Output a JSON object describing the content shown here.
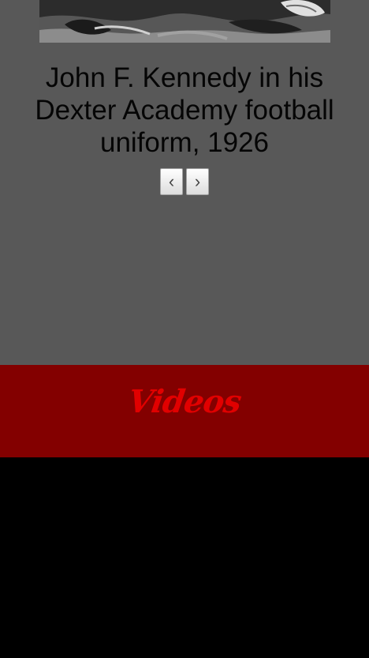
{
  "gallery": {
    "caption": "John F. Kennedy in his Dexter Academy football uniform, 1926",
    "navigation": {
      "previous_label": "‹",
      "next_label": "›"
    }
  },
  "videos": {
    "title": "Videos"
  },
  "colors": {
    "gallery_background": "#585858",
    "videos_band_background": "#830000",
    "videos_title_color": "#e10000",
    "lower_background": "#000000"
  },
  "icons": {
    "previous": "chevron-left-icon",
    "next": "chevron-right-icon"
  }
}
